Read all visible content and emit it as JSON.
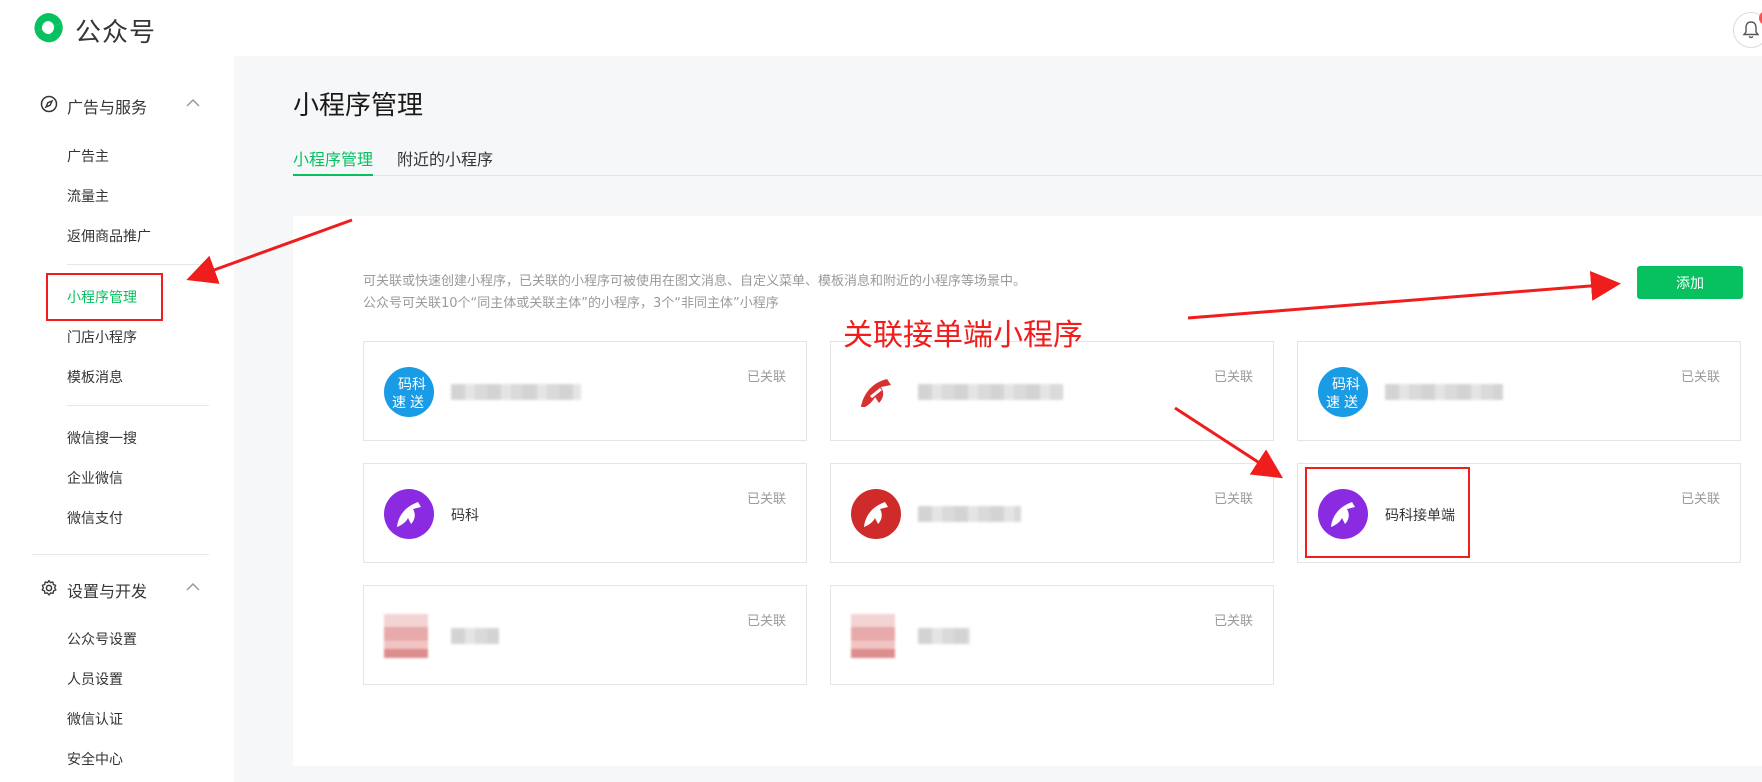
{
  "header": {
    "brand": "公众号",
    "colors": {
      "brand_green": "#07c160",
      "notice_red": "#fa5151"
    }
  },
  "sidebar": {
    "groups": [
      {
        "label": "广告与服务",
        "icon": "compass-icon",
        "items": [
          "广告主",
          "流量主",
          "返佣商品推广"
        ]
      }
    ],
    "items_a": [
      "小程序管理",
      "门店小程序",
      "模板消息"
    ],
    "items_b": [
      "微信搜一搜",
      "企业微信",
      "微信支付"
    ],
    "group2": {
      "label": "设置与开发",
      "icon": "gear-icon",
      "items": [
        "公众号设置",
        "人员设置",
        "微信认证",
        "安全中心"
      ]
    },
    "active_item": "小程序管理"
  },
  "main": {
    "title": "小程序管理",
    "tabs": [
      {
        "label": "小程序管理",
        "active": true
      },
      {
        "label": "附近的小程序",
        "active": false
      }
    ],
    "description": [
      "可关联或快速创建小程序，已关联的小程序可被使用在图文消息、自定义菜单、模板消息和附近的小程序等场景中。",
      "公众号可关联10个“同主体或关联主体”的小程序，3个“非同主体”小程序"
    ],
    "add_button": "添加",
    "cards": [
      {
        "name": "",
        "status": "已关联",
        "avatar": "speed-delivery-logo"
      },
      {
        "name": "",
        "status": "已关联",
        "avatar": "red-horse-logo"
      },
      {
        "name": "",
        "status": "已关联",
        "avatar": "speed-delivery-logo"
      },
      {
        "name": "码科",
        "status": "已关联",
        "avatar": "purple-horse-logo"
      },
      {
        "name": "",
        "status": "已关联",
        "avatar": "red-horse-logo"
      },
      {
        "name": "码科接单端",
        "status": "已关联",
        "avatar": "purple-horse-logo"
      },
      {
        "name": "",
        "status": "已关联",
        "avatar": "blurred-logo"
      },
      {
        "name": "",
        "status": "已关联",
        "avatar": "blurred-logo"
      }
    ],
    "logo_text": [
      "码",
      "科",
      "速",
      "送"
    ]
  },
  "annotation": {
    "text": "关联接单端小程序",
    "color": "#f01d1d"
  }
}
